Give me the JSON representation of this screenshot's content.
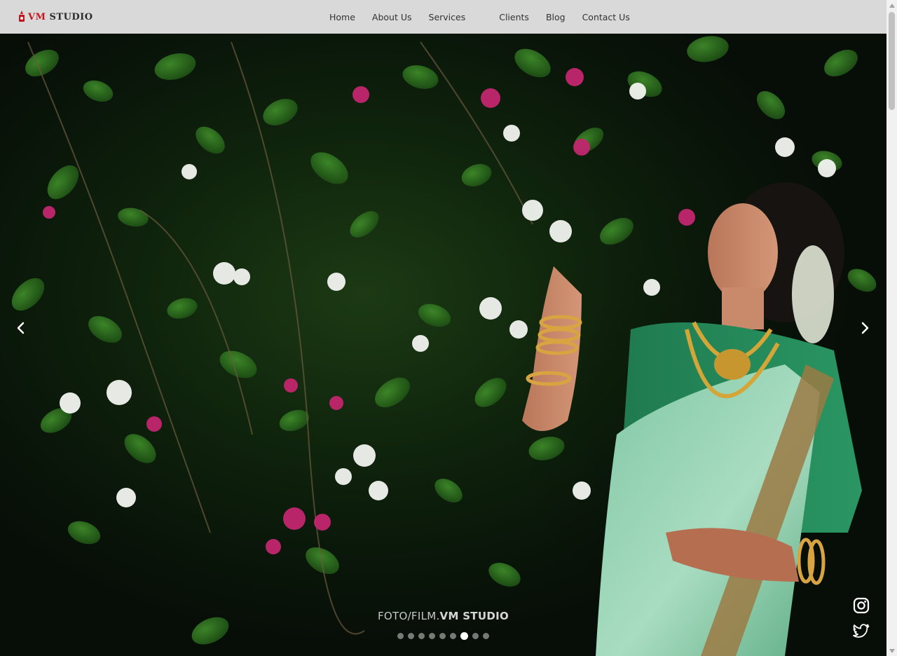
{
  "brand": {
    "logo_prefix": "VM",
    "logo_suffix": " STUDIO",
    "accent_color": "#c4161c"
  },
  "nav": {
    "items": [
      {
        "label": "Home"
      },
      {
        "label": "About Us"
      },
      {
        "label": "Services"
      },
      {
        "label": "Clients"
      },
      {
        "label": "Blog"
      },
      {
        "label": "Contact Us"
      }
    ]
  },
  "hero": {
    "caption_light": "FOTO/FILM.",
    "caption_bold": "VM STUDIO",
    "slide_count": 9,
    "active_slide": 7,
    "prev_icon": "chevron-left-icon",
    "next_icon": "chevron-right-icon"
  },
  "social": {
    "items": [
      {
        "icon": "instagram-icon"
      },
      {
        "icon": "twitter-icon"
      }
    ]
  }
}
